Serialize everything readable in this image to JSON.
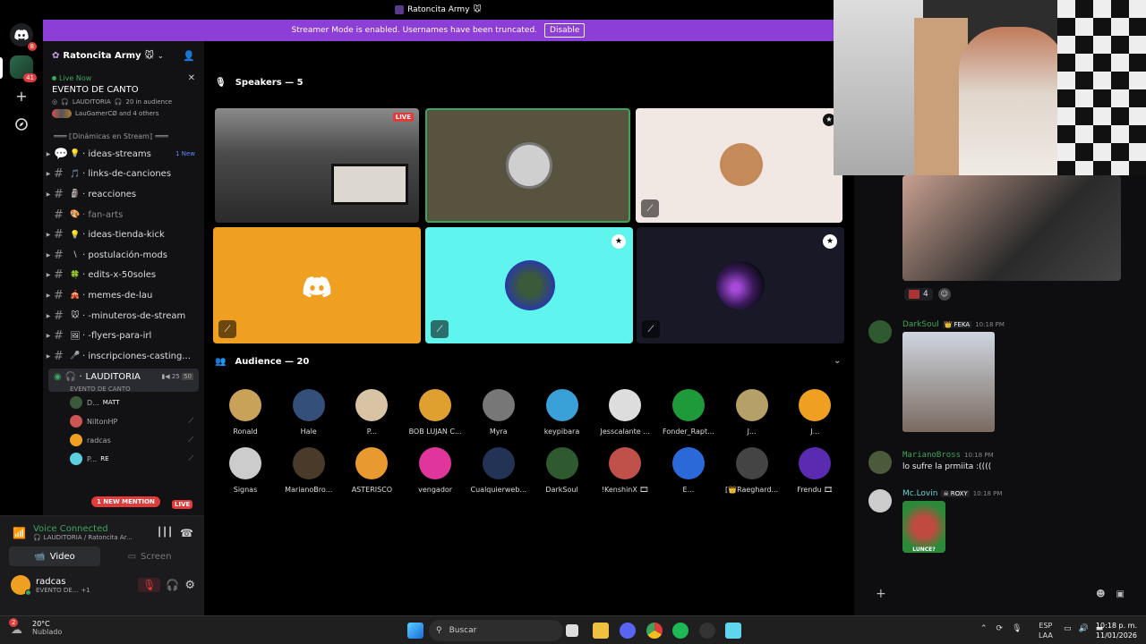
{
  "window_title": "Ratoncita Army",
  "banner": {
    "text": "Streamer Mode is enabled. Usernames have been truncated.",
    "button": "Disable"
  },
  "rail": {
    "badge_top": "8",
    "badge_server": "41"
  },
  "server": {
    "name": "Ratoncita Army"
  },
  "live_event": {
    "live_label": "Live Now",
    "title": "EVENTO DE CANTO",
    "channel": "LAUDITORIA",
    "audience": "20 in audience",
    "others": "LauGamerCØ and 4 others"
  },
  "category": "Dinámicas en Stream",
  "channels": [
    {
      "name": "ideas-streams",
      "emoji": "💡",
      "tag": "1 New",
      "arrow": true,
      "kind": "forum"
    },
    {
      "name": "links-de-canciones",
      "emoji": "🎵",
      "arrow": true
    },
    {
      "name": "reacciones",
      "emoji": "🗿",
      "arrow": true
    },
    {
      "name": "fan-arts",
      "emoji": "🎨",
      "arrow": false,
      "muted": true
    },
    {
      "name": "ideas-tienda-kick",
      "emoji": "💡",
      "arrow": true
    },
    {
      "name": "postulación-mods",
      "emoji": "\\",
      "arrow": true
    },
    {
      "name": "edits-x-50soles",
      "emoji": "🍀",
      "arrow": true
    },
    {
      "name": "memes-de-lau",
      "emoji": "🎪",
      "arrow": true
    },
    {
      "name": "-minuteros-de-stream",
      "emoji": "🐭",
      "arrow": true
    },
    {
      "name": "-flyers-para-irl",
      "emoji": "🖼",
      "arrow": true
    },
    {
      "name": "inscripciones-casting...",
      "emoji": "🎤",
      "arrow": true
    }
  ],
  "stage_channel": {
    "name": "LAUDITORIA",
    "subtitle": "EVENTO DE CANTO",
    "count1": "25",
    "count2": "50"
  },
  "stage_users": [
    {
      "name": "D...",
      "tag": "MATT"
    },
    {
      "name": "NiltonHP",
      "tag": ""
    },
    {
      "name": "radcas",
      "tag": ""
    },
    {
      "name": "P...",
      "tag": "RE"
    }
  ],
  "new_mention": "1 NEW MENTION",
  "live_tag": "LIVE",
  "voice": {
    "status": "Voice Connected",
    "channel": "LAUDITORIA / Ratoncita Ar...",
    "video": "Video",
    "screen": "Screen"
  },
  "user": {
    "name": "radcas",
    "status": "EVENTO DE...",
    "extra": "+1"
  },
  "speakers_header": "Speakers — 5",
  "audience_header": "Audience — 20",
  "speaker_live": "LIVE",
  "audience": [
    {
      "name": "Ronald",
      "color": "#c9a25a"
    },
    {
      "name": "Hale",
      "color": "#34507a"
    },
    {
      "name": "P...",
      "color": "#d8c3a5"
    },
    {
      "name": "BOB LUJAN C...",
      "color": "#e0a030"
    },
    {
      "name": "Myra",
      "color": "#777777"
    },
    {
      "name": "keypibara",
      "color": "#3aa0d8"
    },
    {
      "name": "Jesscalante ...",
      "color": "#dddddd"
    },
    {
      "name": "Fonder_Rapt...",
      "color": "#1e9a3a"
    },
    {
      "name": "J...",
      "color": "#b5a06a"
    },
    {
      "name": "J...",
      "color": "#f0a020"
    },
    {
      "name": "Signas",
      "color": "#cccccc"
    },
    {
      "name": "MarianoBro...",
      "color": "#4a3a2a"
    },
    {
      "name": "ASTERISCO",
      "color": "#e89a30"
    },
    {
      "name": "vengador",
      "color": "#e0359a"
    },
    {
      "name": "Cualquierweb...",
      "color": "#223355"
    },
    {
      "name": "DarkSoul",
      "color": "#2f5a2f"
    },
    {
      "name": "!KenshinX 🎞",
      "color": "#c0504a"
    },
    {
      "name": "E...",
      "color": "#2a6ad8"
    },
    {
      "name": "[👑Raeghard...",
      "color": "#444444"
    },
    {
      "name": "Frendu 🎞",
      "color": "#5a2ab0"
    }
  ],
  "chat": {
    "reaction_count": "4",
    "messages": [
      {
        "user": "DarkSoul",
        "role": "FEKA",
        "time": "10:18 PM",
        "text": ""
      },
      {
        "user": "MarianoBross",
        "role": "",
        "time": "10:18 PM",
        "text": "lo sufre la prmiita :(((("
      },
      {
        "user": "Mc.Lovin",
        "role": "ROXY",
        "time": "10:18 PM",
        "text": ""
      }
    ],
    "sticker_caption": "LUNCE?"
  },
  "taskbar": {
    "weather_temp": "20°C",
    "weather_desc": "Nublado",
    "weather_badge": "2",
    "search": "Buscar",
    "lang1": "ESP",
    "lang2": "LAA",
    "time": "10:18 p. m.",
    "date": "11/01/2026"
  },
  "colors": {
    "accent": "#5865f2",
    "banner": "#8c3ed6",
    "live": "#e03c3c",
    "speaking": "#3ba55d",
    "teal": "#5ff5ee",
    "orange": "#f0a020"
  }
}
